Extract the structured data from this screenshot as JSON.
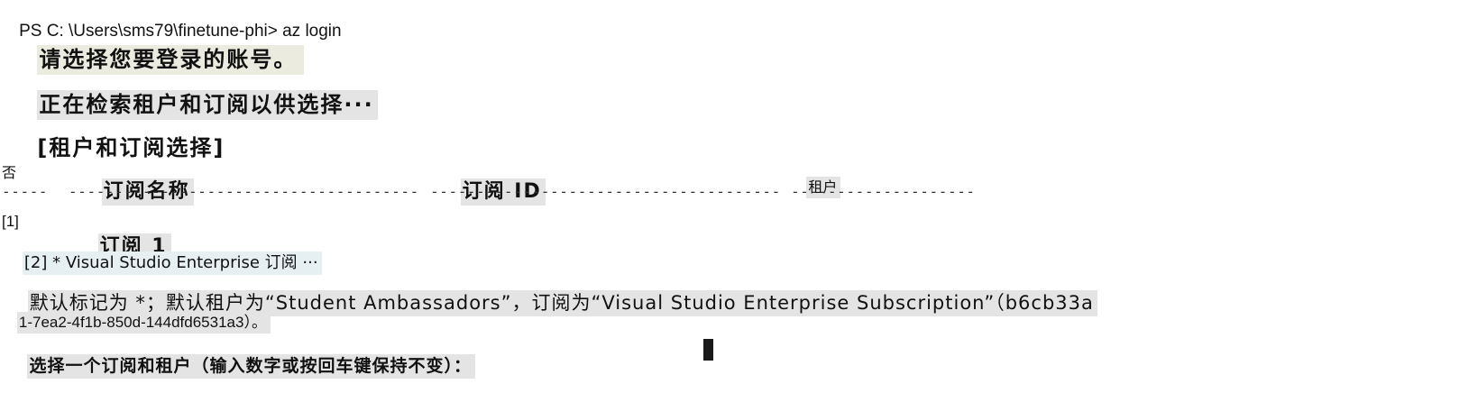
{
  "terminal": {
    "prompt_line": "PS C: \\Users\\sms79\\finetune-phi> az login",
    "select_account": "请选择您要登录的账号。",
    "retrieving": "正在检索租户和订阅以供选择···",
    "section_title": "[租户和订阅选择]",
    "table": {
      "headers": {
        "no": "否",
        "subscription_name": "订阅名称",
        "subscription_id": "订阅 ID",
        "tenant": "租户"
      },
      "dashes": {
        "no": "-----",
        "subscription_name": "--------------------------------------",
        "subscription_id": "--------------------------------------",
        "tenant": "--------------------"
      },
      "rows": [
        {
          "index": "[1]",
          "name": "订阅 1"
        },
        {
          "text": "[2] * Visual Studio Enterprise 订阅 ···"
        }
      ]
    },
    "default_note_line1": "默认标记为 *；默认租户为“Student Ambassadors”，订阅为“Visual Studio Enterprise Subscription”（b6cb33a",
    "default_note_line2": "1-7ea2-4f1b-850d-144dfd6531a3）。",
    "input_prompt": "选择一个订阅和租户（输入数字或按回车键保持不变）："
  }
}
